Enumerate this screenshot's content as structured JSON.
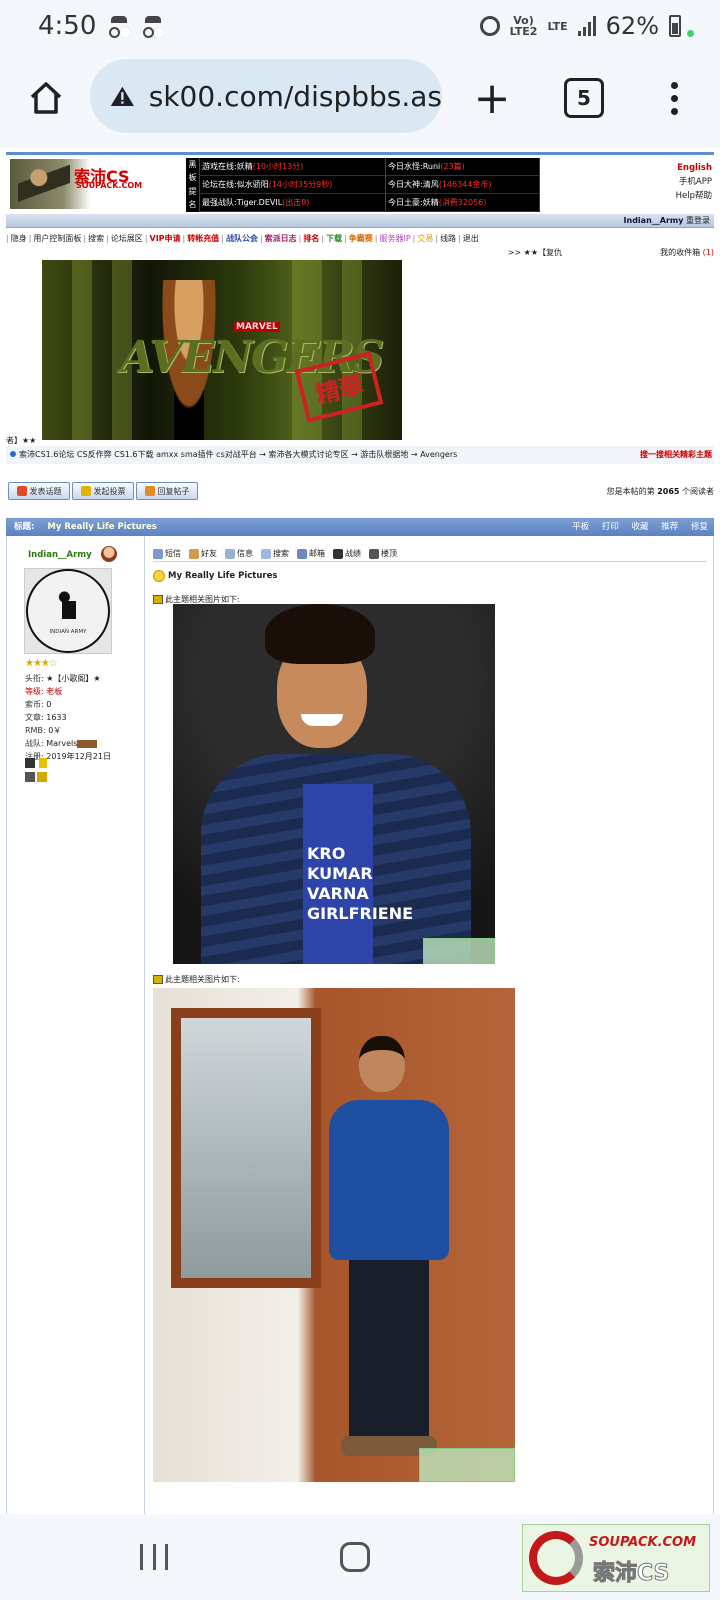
{
  "status_bar": {
    "time": "4:50",
    "volte_line1": "Vo)",
    "volte_line2": "LTE2",
    "network": "LTE",
    "battery": "62%"
  },
  "browser": {
    "url": "sk00.com/dispbbs.as",
    "tab_count": "5",
    "new_tab": "+"
  },
  "site": {
    "logo_text": "索沛CS",
    "logo_sub": "SOUPACK.COM",
    "board_label": [
      "黑",
      "板",
      "提",
      "名"
    ],
    "board": [
      {
        "text": "游戏在线:妖精",
        "red": "(10小时13分)"
      },
      {
        "text": "今日水怪:Runi",
        "red": "(23篇)"
      },
      {
        "text": "论坛在线:似水骄阳",
        "red": "(14小时35分9秒)"
      },
      {
        "text": "今日大神:清风",
        "red": "(146344金币)"
      },
      {
        "text": "最强战队:Tiger.DEVIL",
        "red": "(出击8)"
      },
      {
        "text": "今日土豪:妖精",
        "red": "(消费32056)"
      }
    ],
    "top_links": {
      "english": "English",
      "app": "手机APP",
      "help": "Help帮助"
    },
    "user_strip": {
      "user": "Indian__Army",
      "action": "重登录"
    },
    "nav": [
      "隐身",
      "用户控制面板",
      "搜索",
      "论坛展区",
      "VIP申请",
      "转帐充值",
      "战队公会",
      "索派日志",
      "排名",
      "下载",
      "争霸赛",
      "服务器IP",
      "交易",
      "线路",
      "退出"
    ],
    "sub_nav_left": ">> ★★【复仇",
    "sub_nav_right_label": "我的收件箱",
    "sub_nav_right_count": "(1)",
    "hero": {
      "title": "AVENGERS",
      "marvel": "MARVEL",
      "stamp": "精華",
      "caption": "者】★★"
    },
    "breadcrumb": "索沛CS1.6论坛 CS反作弊 CS1.6下载 amxx sma插件 cs对战平台 → 索沛各大模式讨论专区 → 游击队根据地 → Avengers",
    "search_link": "搜一搜相关精彩主题",
    "actions": [
      "发表话题",
      "发起投票",
      "回复帖子"
    ],
    "read_count": {
      "prefix": "您是本帖的第",
      "number": "2065",
      "suffix": "个阅读者"
    }
  },
  "post": {
    "header_label": "标题:",
    "title": "My Really Life Pictures",
    "header_tools": [
      "平板",
      "打印",
      "收藏",
      "推荐",
      "修复"
    ],
    "author": {
      "name": "Indian__Army",
      "avatar_text": "INDIAN ARMY",
      "stars": "★★★☆",
      "rows": [
        {
          "label": "头衔:",
          "value": "★【小歌阁】★"
        },
        {
          "label": "等级:",
          "value": "老板"
        },
        {
          "label": "索币:",
          "value": "0"
        },
        {
          "label": "文章:",
          "value": "1633"
        },
        {
          "label": "RMB:",
          "value": "0￥"
        },
        {
          "label": "战队:",
          "value": "Marvels"
        },
        {
          "label": "注册:",
          "value": "2019年12月21日"
        }
      ]
    },
    "tools": [
      "短信",
      "好友",
      "信息",
      "搜索",
      "邮箱",
      "战绩",
      "楼顶"
    ],
    "body_title": "My Really Life Pictures",
    "image_caption": "此主题相关图片如下:",
    "shirt_text": "KRO\nKUMAR\nVARNA\nGIRLFRIENE"
  }
}
